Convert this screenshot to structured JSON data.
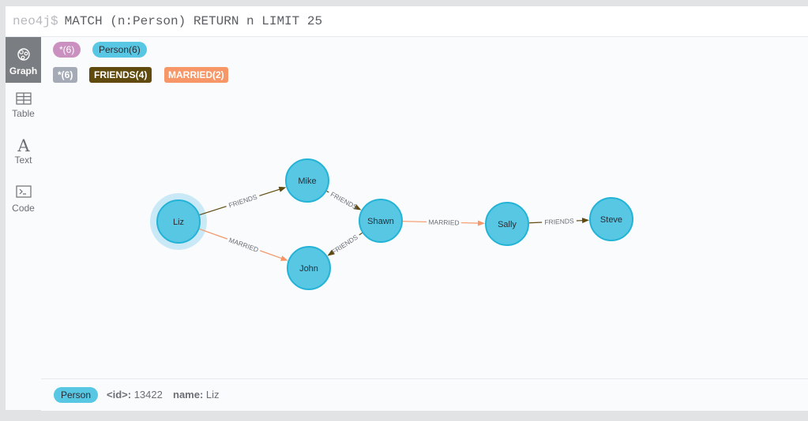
{
  "query": {
    "prompt": "neo4j$",
    "text": "MATCH (n:Person) RETURN n LIMIT 25"
  },
  "sidebar": {
    "items": [
      {
        "label": "Graph",
        "icon": "graph-icon",
        "active": true
      },
      {
        "label": "Table",
        "icon": "table-icon",
        "active": false
      },
      {
        "label": "Text",
        "icon": "text-icon",
        "active": false
      },
      {
        "label": "Code",
        "icon": "code-icon",
        "active": false
      }
    ]
  },
  "legend": {
    "labels": {
      "all": {
        "name": "*",
        "count": "(6)",
        "color": "#c990c0"
      },
      "person": {
        "name": "Person",
        "count": "(6)",
        "color": "#57c7e3"
      }
    },
    "relationships": {
      "all": {
        "name": "*",
        "count": "(6)",
        "color": "#a5abb6"
      },
      "friends": {
        "name": "FRIENDS",
        "count": "(4)",
        "color": "#604a0e"
      },
      "married": {
        "name": "MARRIED",
        "count": "(2)",
        "color": "#f79767"
      }
    }
  },
  "graph": {
    "node_color": "#57c7e3",
    "node_border": "#23b3d7",
    "selected_halo": "#c9e9f7",
    "nodes": [
      {
        "id": "liz",
        "name": "Liz",
        "selected": true
      },
      {
        "id": "mike",
        "name": "Mike"
      },
      {
        "id": "john",
        "name": "John"
      },
      {
        "id": "shawn",
        "name": "Shawn"
      },
      {
        "id": "sally",
        "name": "Sally"
      },
      {
        "id": "steve",
        "name": "Steve"
      }
    ],
    "relationships": [
      {
        "from": "liz",
        "to": "mike",
        "type": "FRIENDS",
        "color": "#604a0e"
      },
      {
        "from": "liz",
        "to": "john",
        "type": "MARRIED",
        "color": "#f79767"
      },
      {
        "from": "mike",
        "to": "shawn",
        "type": "FRIENDS",
        "color": "#604a0e"
      },
      {
        "from": "shawn",
        "to": "john",
        "type": "FRIENDS",
        "color": "#604a0e"
      },
      {
        "from": "shawn",
        "to": "sally",
        "type": "MARRIED",
        "color": "#f79767"
      },
      {
        "from": "sally",
        "to": "steve",
        "type": "FRIENDS",
        "color": "#604a0e"
      }
    ]
  },
  "status": {
    "label_badge": "Person",
    "id_key": "<id>:",
    "id_value": "13422",
    "name_key": "name:",
    "name_value": "Liz"
  }
}
